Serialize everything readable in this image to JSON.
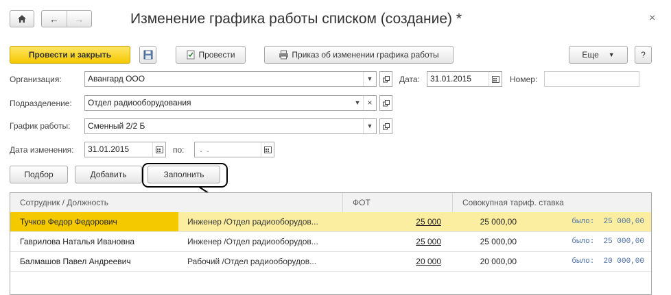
{
  "window": {
    "title": "Изменение графика работы списком (создание) *"
  },
  "toolbar": {
    "post_close_label": "Провести и закрыть",
    "post_label": "Провести",
    "print_order_label": "Приказ об изменении графика работы",
    "more_label": "Еще",
    "help_label": "?"
  },
  "form": {
    "org_label": "Организация:",
    "org_value": "Авангард ООО",
    "date_label": "Дата:",
    "date_value": "31.01.2015",
    "number_label": "Номер:",
    "number_value": "",
    "dept_label": "Подразделение:",
    "dept_value": "Отдел радиооборудования",
    "schedule_label": "График работы:",
    "schedule_value": "Сменный 2/2 Б",
    "change_date_label": "Дата изменения:",
    "change_date_value": "31.01.2015",
    "to_label": "по:",
    "to_value": " .  ."
  },
  "table_toolbar": {
    "select_label": "Подбор",
    "add_label": "Добавить",
    "fill_label": "Заполнить"
  },
  "table": {
    "columns": [
      "Сотрудник / Должность",
      "ФОТ",
      "Совокупная тариф. ставка"
    ],
    "rows": [
      {
        "name": "Тучков Федор Федорович",
        "position": "Инженер /Отдел радиооборудов...",
        "fot": "25 000",
        "rate": "25 000,00",
        "was": "было:  25 000,00"
      },
      {
        "name": "Гаврилова Наталья Ивановна",
        "position": "Инженер /Отдел радиооборудов...",
        "fot": "25 000",
        "rate": "25 000,00",
        "was": "было:  25 000,00"
      },
      {
        "name": "Балмашов Павел Андреевич",
        "position": "Рабочий /Отдел радиооборудов...",
        "fot": "20 000",
        "rate": "20 000,00",
        "was": "было:  20 000,00"
      }
    ]
  },
  "colors": {
    "accent_yellow": "#f5c900",
    "selected_row": "#fbeea0"
  }
}
